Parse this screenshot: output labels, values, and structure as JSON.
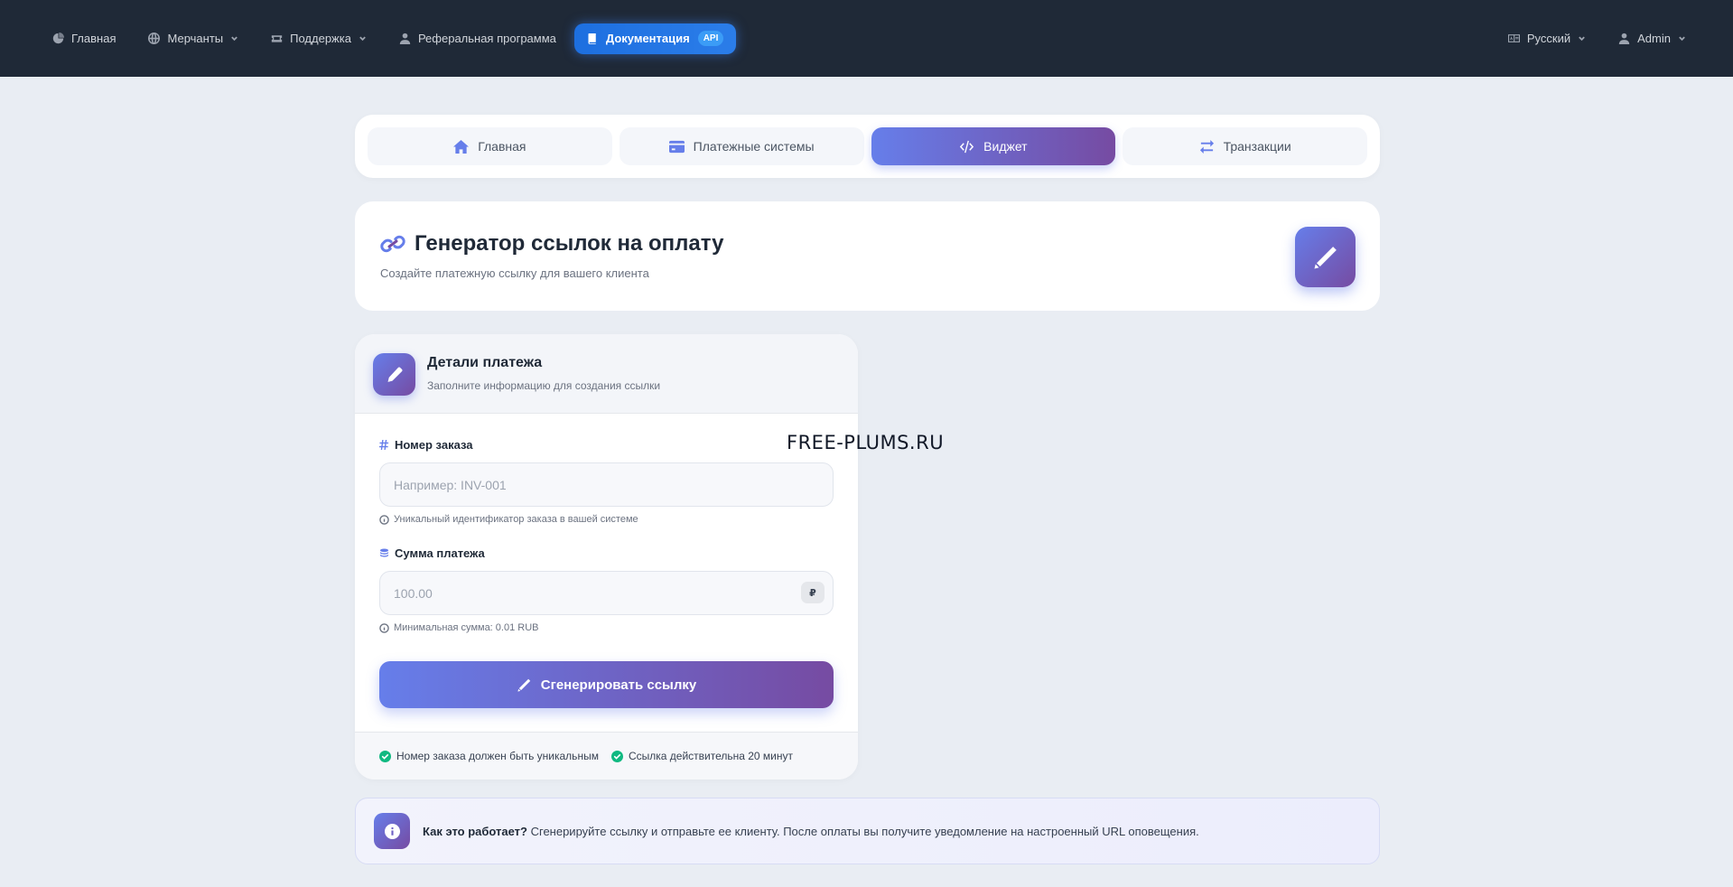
{
  "topnav": {
    "items": [
      {
        "label": "Главная",
        "icon": "dashboard-icon"
      },
      {
        "label": "Мерчанты",
        "icon": "globe-icon",
        "dropdown": true
      },
      {
        "label": "Поддержка",
        "icon": "ticket-icon",
        "dropdown": true
      },
      {
        "label": "Реферальная программа",
        "icon": "user-icon"
      }
    ],
    "docs": {
      "label": "Документация",
      "badge": "API",
      "icon": "book-icon"
    },
    "language": "Русский",
    "user": "Admin"
  },
  "tabs": [
    {
      "label": "Главная",
      "icon": "home-icon"
    },
    {
      "label": "Платежные системы",
      "icon": "credit-card-icon"
    },
    {
      "label": "Виджет",
      "icon": "code-icon",
      "active": true
    },
    {
      "label": "Транзакции",
      "icon": "exchange-icon"
    }
  ],
  "header": {
    "title": "Генератор ссылок на оплату",
    "subtitle": "Создайте платежную ссылку для вашего клиента",
    "title_icon": "link-icon",
    "action_icon": "magic-wand-icon"
  },
  "form": {
    "title": "Детали платежа",
    "subtitle": "Заполните информацию для создания ссылки",
    "order": {
      "label": "Номер заказа",
      "placeholder": "Например: INV-001",
      "value": "",
      "hint": "Уникальный идентификатор заказа в вашей системе"
    },
    "amount": {
      "label": "Сумма платежа",
      "placeholder": "100.00",
      "value": "",
      "currency": "₽",
      "hint": "Минимальная сумма: 0.01 RUB"
    },
    "submit_label": "Сгенерировать ссылку",
    "notes": [
      "Номер заказа должен быть уникальным",
      "Ссылка действительна 20 минут"
    ]
  },
  "info": {
    "title": "Как это работает?",
    "text": " Сгенерируйте ссылку и отправьте ее клиенту. После оплаты вы получите уведомление на настроенный URL оповещения."
  },
  "watermark": "FREE-PLUMS.RU",
  "colors": {
    "navbar": "#1f2937",
    "accent_start": "#667eea",
    "accent_end": "#764ba2",
    "docs_button": "#2b7de9",
    "success": "#10b981",
    "background": "#e9edf3"
  }
}
